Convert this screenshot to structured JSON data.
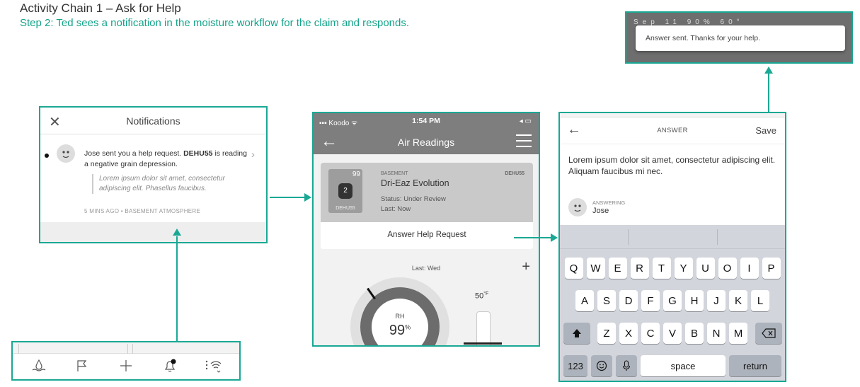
{
  "heading": {
    "title": "Activity Chain 1 – Ask for Help",
    "step": "Step 2: Ted sees a notification in the moisture workflow for the claim and responds."
  },
  "colors": {
    "accent": "#1aa894",
    "step_text": "#14a38b"
  },
  "notifications": {
    "close_icon": "close-icon",
    "title": "Notifications",
    "item": {
      "sender": "Jose sent you a help request.",
      "code": "DEHU55",
      "rest": "is reading a negative grain depression.",
      "quote": "Lorem ipsum dolor sit amet, consectetur adipiscing elit. Phasellus faucibus.",
      "meta": "5 MINS AGO • BASEMENT ATMOSPHERE"
    }
  },
  "tabbar": {
    "icons": [
      "moisture-icon",
      "flag-icon",
      "plus-icon",
      "bell-icon",
      "wifi-sensor-icon"
    ]
  },
  "air_readings": {
    "status": {
      "carrier": "Koodo",
      "time": "1:54 PM"
    },
    "title": "Air Readings",
    "card": {
      "badge_number": "99",
      "device_number": "2",
      "device_label": "DEHU55",
      "location": "BASEMENT",
      "name": "Dri-Eaz Evolution",
      "code": "DEHU55",
      "status": "Status: Under Review",
      "last": "Last: Now",
      "action": "Answer Help Request"
    },
    "last_reading": "Last: Wed",
    "plus": "+",
    "gauge": {
      "label": "RH",
      "value": "99",
      "unit": "%"
    },
    "temperature": {
      "value": "50",
      "unit": "°F"
    }
  },
  "answer": {
    "title": "ANSWER",
    "save": "Save",
    "text": "Lorem ipsum dolor sit amet, consectetur adipiscing elit. Aliquam faucibus mi nec.",
    "answering_label": "ANSWERING",
    "answering_name": "Jose",
    "keyboard": {
      "row1": [
        "Q",
        "W",
        "E",
        "R",
        "T",
        "Y",
        "U",
        "O",
        "I",
        "P"
      ],
      "row2": [
        "A",
        "S",
        "D",
        "F",
        "G",
        "H",
        "J",
        "K",
        "L"
      ],
      "row3": [
        "Z",
        "X",
        "C",
        "V",
        "B",
        "N",
        "M"
      ],
      "numbers": "123",
      "space": "space",
      "return": "return"
    }
  },
  "toast": {
    "top_row": "Sep 11  90%  60°",
    "message": "Answer sent. Thanks for your help."
  }
}
